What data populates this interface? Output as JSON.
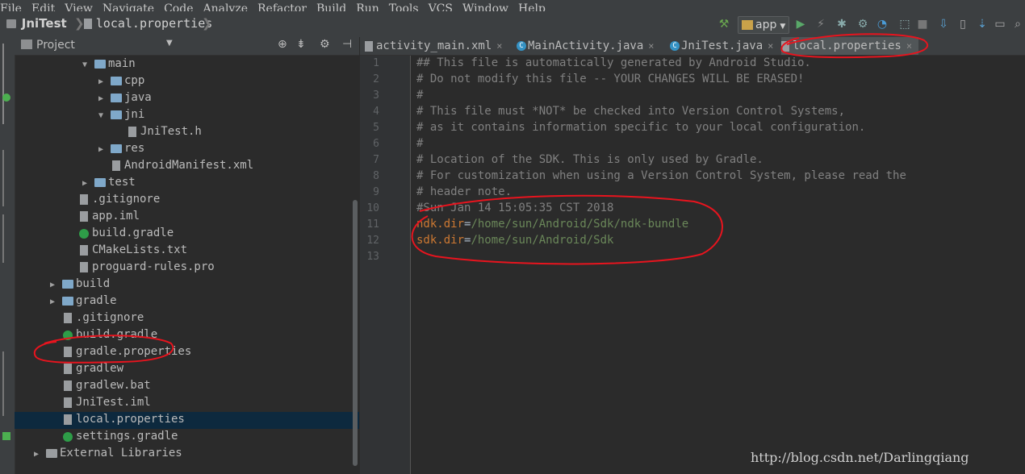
{
  "menu": [
    "File",
    "Edit",
    "View",
    "Navigate",
    "Code",
    "Analyze",
    "Refactor",
    "Build",
    "Run",
    "Tools",
    "VCS",
    "Window",
    "Help"
  ],
  "breadcrumb": {
    "project": "JniTest",
    "file": "local.properties"
  },
  "toolbar": {
    "run_config": "app"
  },
  "project_panel": {
    "title": "Project"
  },
  "tree": [
    {
      "label": "main",
      "depth": 3,
      "arrow": "open",
      "icon": "folder"
    },
    {
      "label": "cpp",
      "depth": 4,
      "arrow": "closed",
      "icon": "folder"
    },
    {
      "label": "java",
      "depth": 4,
      "arrow": "closed",
      "icon": "folder"
    },
    {
      "label": "jni",
      "depth": 4,
      "arrow": "open",
      "icon": "folder"
    },
    {
      "label": "JniTest.h",
      "depth": 5,
      "arrow": "none",
      "icon": "file"
    },
    {
      "label": "res",
      "depth": 4,
      "arrow": "closed",
      "icon": "folder"
    },
    {
      "label": "AndroidManifest.xml",
      "depth": 4,
      "arrow": "none",
      "icon": "file"
    },
    {
      "label": "test",
      "depth": 3,
      "arrow": "closed",
      "icon": "folder"
    },
    {
      "label": ".gitignore",
      "depth": 2,
      "arrow": "none",
      "icon": "file"
    },
    {
      "label": "app.iml",
      "depth": 2,
      "arrow": "none",
      "icon": "file"
    },
    {
      "label": "build.gradle",
      "depth": 2,
      "arrow": "none",
      "icon": "gradle"
    },
    {
      "label": "CMakeLists.txt",
      "depth": 2,
      "arrow": "none",
      "icon": "file"
    },
    {
      "label": "proguard-rules.pro",
      "depth": 2,
      "arrow": "none",
      "icon": "file"
    },
    {
      "label": "build",
      "depth": 1,
      "arrow": "closed",
      "icon": "folder"
    },
    {
      "label": "gradle",
      "depth": 1,
      "arrow": "closed",
      "icon": "folder"
    },
    {
      "label": ".gitignore",
      "depth": 1,
      "arrow": "none",
      "icon": "file"
    },
    {
      "label": "build.gradle",
      "depth": 1,
      "arrow": "none",
      "icon": "gradle"
    },
    {
      "label": "gradle.properties",
      "depth": 1,
      "arrow": "none",
      "icon": "file"
    },
    {
      "label": "gradlew",
      "depth": 1,
      "arrow": "none",
      "icon": "file"
    },
    {
      "label": "gradlew.bat",
      "depth": 1,
      "arrow": "none",
      "icon": "file"
    },
    {
      "label": "JniTest.iml",
      "depth": 1,
      "arrow": "none",
      "icon": "file"
    },
    {
      "label": "local.properties",
      "depth": 1,
      "arrow": "none",
      "icon": "file"
    },
    {
      "label": "settings.gradle",
      "depth": 1,
      "arrow": "none",
      "icon": "gradle"
    },
    {
      "label": "External Libraries",
      "depth": 0,
      "arrow": "closed",
      "icon": "lib"
    }
  ],
  "tabs": [
    {
      "label": "activity_main.xml",
      "icon": "xml"
    },
    {
      "label": "MainActivity.java",
      "icon": "class"
    },
    {
      "label": "JniTest.java",
      "icon": "class"
    },
    {
      "label": "local.properties",
      "icon": "props",
      "active": true
    }
  ],
  "editor": {
    "line_numbers": [
      "1",
      "2",
      "3",
      "4",
      "5",
      "6",
      "7",
      "8",
      "9",
      "10",
      "11",
      "12",
      "13"
    ],
    "lines": [
      {
        "text": "## This file is automatically generated by Android Studio."
      },
      {
        "text": "# Do not modify this file -- YOUR CHANGES WILL BE ERASED!"
      },
      {
        "text": "#"
      },
      {
        "text": "# This file must *NOT* be checked into Version Control Systems,"
      },
      {
        "text": "# as it contains information specific to your local configuration."
      },
      {
        "text": "#"
      },
      {
        "text": "# Location of the SDK. This is only used by Gradle."
      },
      {
        "text": "# For customization when using a Version Control System, please read the"
      },
      {
        "text": "# header note."
      },
      {
        "text": "#Sun Jan 14 15:05:35 CST 2018"
      },
      {
        "key": "ndk.dir",
        "value": "/home/sun/Android/Sdk/ndk-bundle"
      },
      {
        "key": "sdk.dir",
        "value": "/home/sun/Android/Sdk"
      },
      {
        "text": ""
      }
    ]
  },
  "watermark": "http://blog.csdn.net/Darlingqiang",
  "colors": {
    "annotation": "#e8141e",
    "comment": "#808080",
    "key": "#cc7832",
    "value": "#6a8759"
  }
}
